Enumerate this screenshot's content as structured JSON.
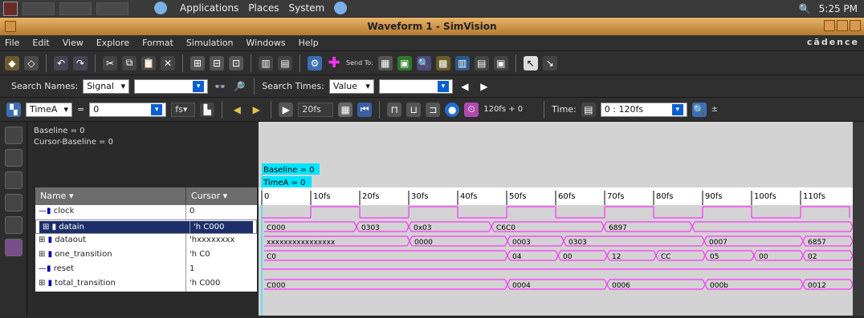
{
  "topbar": {
    "menus": [
      "Applications",
      "Places",
      "System"
    ],
    "time": "5:25 PM"
  },
  "window": {
    "title": "Waveform 1 - SimVision"
  },
  "menubar": {
    "items": [
      "File",
      "Edit",
      "View",
      "Explore",
      "Format",
      "Simulation",
      "Windows",
      "Help"
    ],
    "brand": "cādence"
  },
  "toolbar1": {
    "send_to_label": "Send To:"
  },
  "search": {
    "names_label": "Search Names:",
    "names_select": "Signal",
    "names_value": "",
    "times_label": "Search Times:",
    "times_select": "Value",
    "times_value": ""
  },
  "toolbar3": {
    "time_select": "TimeA",
    "equals": "=",
    "time_value": "0",
    "unit": "fs",
    "zoom": "20fs",
    "sim_time": "120fs + 0",
    "time_label": "Time:",
    "time_range": "0 : 120fs"
  },
  "cursorinfo": {
    "baseline": "Baseline = 0",
    "cursor_baseline": "Cursor-Baseline = 0"
  },
  "table": {
    "headers": {
      "name": "Name",
      "cursor": "Cursor"
    },
    "rows": [
      {
        "name": "clock",
        "cursor": "0"
      },
      {
        "name": "datain",
        "cursor": "'h C000"
      },
      {
        "name": "dataout",
        "cursor": "'hxxxxxxxx"
      },
      {
        "name": "one_transition",
        "cursor": "'h C0"
      },
      {
        "name": "reset",
        "cursor": "1"
      },
      {
        "name": "total_transition",
        "cursor": "'h C000"
      }
    ]
  },
  "wave": {
    "baseline_marker": "Baseline = 0",
    "timea_marker": "TimeA = 0",
    "ticks": [
      "0",
      "10fs",
      "20fs",
      "30fs",
      "40fs",
      "50fs",
      "60fs",
      "70fs",
      "80fs",
      "90fs",
      "100fs",
      "110fs"
    ],
    "datain": [
      "C000",
      "0303",
      "0x03",
      "C6C0",
      "6897"
    ],
    "dataout": [
      "xxxxxxxxxxxxxxxx",
      "0000",
      "0003",
      "0303",
      "0007",
      "6857"
    ],
    "one_transition": [
      "C0",
      "04",
      "00",
      "12",
      "CC",
      "05",
      "00",
      "02"
    ],
    "total_transition": [
      "C000",
      "0004",
      "0006",
      "000b",
      "0012"
    ]
  },
  "colors": {
    "accent": "#d89a4e",
    "wave_magenta": "#ff33ff",
    "wave_yellow": "#ffff00",
    "marker_cyan": "#00e5ff",
    "sel_blue": "#1c2f6b"
  }
}
